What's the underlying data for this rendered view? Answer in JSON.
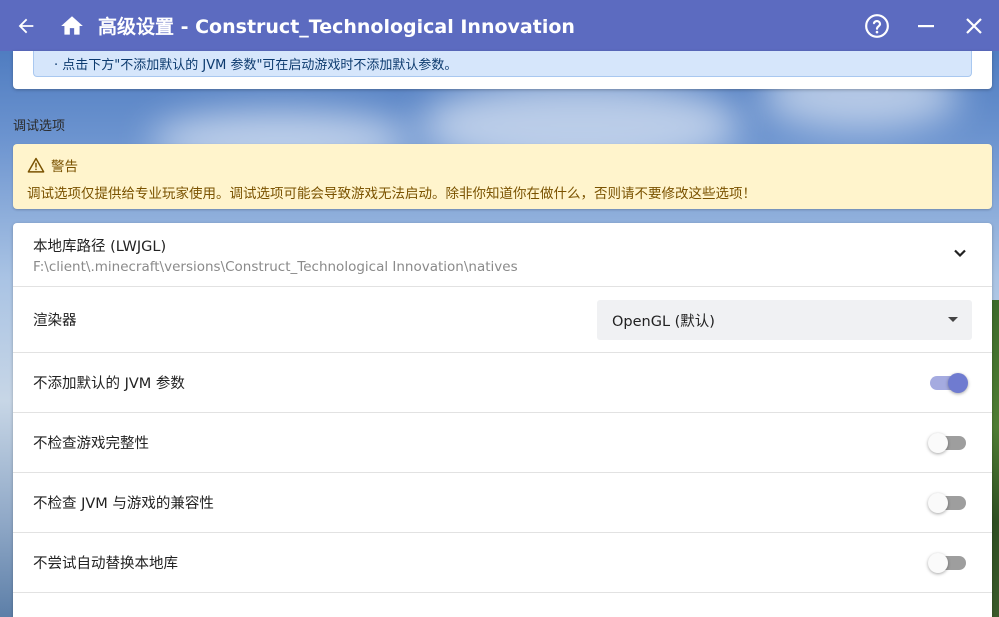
{
  "window": {
    "title": "高级设置 - Construct_Technological Innovation"
  },
  "info_notice": "· 点击下方\"不添加默认的 JVM 参数\"可在启动游戏时不添加默认参数。",
  "debug_section": {
    "label": "调试选项",
    "warning": {
      "title": "警告",
      "body": "调试选项仅提供给专业玩家使用。调试选项可能会导致游戏无法启动。除非你知道你在做什么，否则请不要修改这些选项！"
    }
  },
  "settings": {
    "native_path": {
      "label": "本地库路径 (LWJGL)",
      "value": "F:\\client\\.minecraft\\versions\\Construct_Technological Innovation\\natives"
    },
    "renderer": {
      "label": "渲染器",
      "selected": "OpenGL (默认)"
    },
    "toggles": [
      {
        "label": "不添加默认的 JVM 参数",
        "on": true
      },
      {
        "label": "不检查游戏完整性",
        "on": false
      },
      {
        "label": "不检查 JVM 与游戏的兼容性",
        "on": false
      },
      {
        "label": "不尝试自动替换本地库",
        "on": false
      }
    ]
  },
  "colors": {
    "titlebar": "#5c6bc0",
    "accent": "#6f7bd0",
    "warning_bg": "#fff4cc",
    "info_bg": "#d6e6fb"
  },
  "icons": {
    "back": "back-arrow-icon",
    "home": "home-icon",
    "help": "help-icon",
    "minimize": "minimize-icon",
    "close": "close-icon",
    "warning": "warning-triangle-icon",
    "expand": "chevron-down-icon",
    "dropdown": "dropdown-caret-icon"
  }
}
